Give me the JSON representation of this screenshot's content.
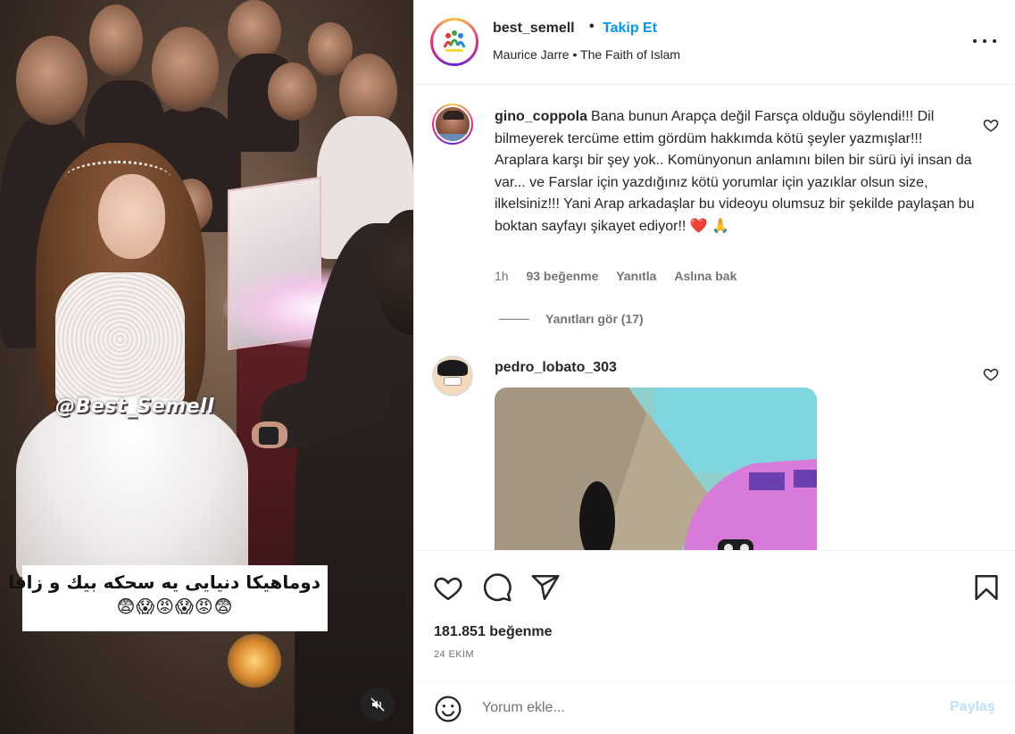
{
  "video": {
    "watermark": "@Best_Semell",
    "caption_arabic": "دوماهیکا دنیایی یه سحکه بیك و زاقا",
    "caption_emojis": "😨😱😡😱😡😨"
  },
  "header": {
    "username": "best_semell",
    "separator": "•",
    "follow_label": "Takip Et",
    "audio_artist": "Maurice Jarre",
    "audio_separator": "•",
    "audio_title": "The Faith of Islam"
  },
  "comments": [
    {
      "username": "gino_coppola",
      "text": "Bana bunun Arapça değil Farsça olduğu söylendi!!! Dil bilmeyerek tercüme ettim gördüm hakkımda kötü şeyler yazmışlar!!! Araplara karşı bir şey yok.. Komünyonun anlamını bilen bir sürü iyi insan da var... ve Farslar için yazdığınız kötü yorumlar için yazıklar olsun size, ilkelsiniz!!! Yani Arap arkadaşlar bu videoyu olumsuz bir şekilde paylaşan bu boktan sayfayı şikayet ediyor!!",
      "emojis": "❤️ 🙏",
      "time": "1h",
      "likes": "93 beğenme",
      "reply_label": "Yanıtla",
      "see_original_label": "Aslına bak",
      "view_replies": "Yanıtları gör (17)"
    },
    {
      "username": "pedro_lobato_303"
    }
  ],
  "actions": {
    "like_count": "181.851 beğenme",
    "date": "24 EKİM"
  },
  "comment_bar": {
    "placeholder": "Yorum ekle...",
    "share_label": "Paylaş"
  },
  "colors": {
    "link_blue": "#0095f6",
    "share_disabled": "#c0dffd",
    "text_primary": "#262626",
    "text_secondary": "#737373",
    "heart_red": "#ed1c24"
  }
}
